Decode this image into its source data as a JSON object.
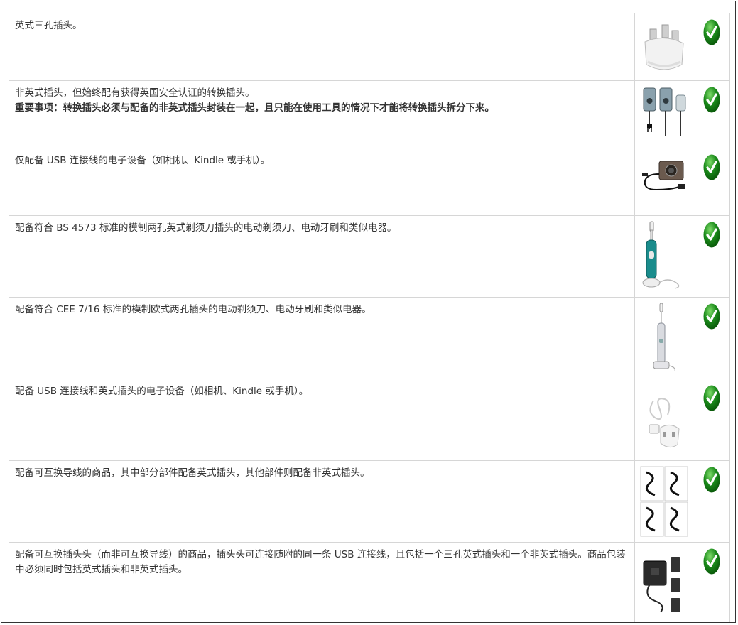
{
  "rows": [
    {
      "text": "英式三孔插头。",
      "note": "",
      "image_icon": "uk-three-pin-plug-icon",
      "status_icon": "green-check-icon"
    },
    {
      "text": "非英式插头，但始终配有获得英国安全认证的转换插头。",
      "note": "重要事项：转换插头必须与配备的非英式插头封装在一起，且只能在使用工具的情况下才能将转换插头拆分下来。",
      "image_icon": "plug-adapter-icon",
      "status_icon": "green-check-icon"
    },
    {
      "text": "仅配备 USB 连接线的电子设备（如相机、Kindle 或手机）。",
      "note": "",
      "image_icon": "camera-usb-cable-icon",
      "status_icon": "green-check-icon"
    },
    {
      "text": "配备符合 BS 4573 标准的模制两孔英式剃须刀插头的电动剃须刀、电动牙刷和类似电器。",
      "note": "",
      "image_icon": "electric-toothbrush-icon",
      "status_icon": "green-check-icon"
    },
    {
      "text": "配备符合 CEE 7/16 标准的模制欧式两孔插头的电动剃须刀、电动牙刷和类似电器。",
      "note": "",
      "image_icon": "sonic-toothbrush-icon",
      "status_icon": "green-check-icon"
    },
    {
      "text": "配备 USB 连接线和英式插头的电子设备（如相机、Kindle 或手机）。",
      "note": "",
      "image_icon": "usb-cable-uk-plug-icon",
      "status_icon": "green-check-icon"
    },
    {
      "text": "配备可互换导线的商品，其中部分部件配备英式插头，其他部件则配备非英式插头。",
      "note": "",
      "image_icon": "interchangeable-cords-icon",
      "status_icon": "green-check-icon"
    },
    {
      "text": "配备可互换插头头（而非可互换导线）的商品，插头头可连接随附的同一条 USB 连接线，且包括一个三孔英式插头和一个非英式插头。商品包装中必须同时包括英式插头和非英式插头。",
      "note": "",
      "image_icon": "interchangeable-plug-heads-icon",
      "status_icon": "green-check-icon"
    }
  ],
  "colors": {
    "check_green": "#1a8a1a",
    "border": "#d6d6d6",
    "text": "#333333"
  }
}
